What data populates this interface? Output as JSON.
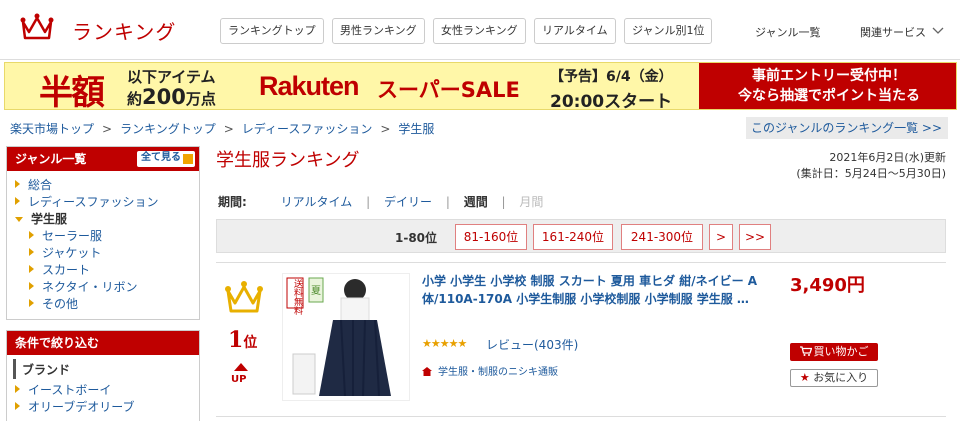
{
  "header": {
    "logo_text": "ランキング",
    "nav": [
      "ランキングトップ",
      "男性ランキング",
      "女性ランキング",
      "リアルタイム",
      "ジャンル別1位"
    ],
    "genre_list": "ジャンル一覧",
    "related": "関連サービス"
  },
  "banner": {
    "half": "半額",
    "under_line1": "以下アイテム",
    "under_line2_pre": "約",
    "under_line2_num": "200",
    "under_line2_post": "万点",
    "rakuten": "Rakuten",
    "super": "スーパーSALE",
    "notice_line1": "【予告】6/4（金）",
    "notice_line2": "20:00スタート",
    "cta_line1": "事前エントリー受付中！",
    "cta_line2": "今なら抽選でポイント当たる"
  },
  "breadcrumb": [
    "楽天市場トップ",
    "ランキングトップ",
    "レディースファッション",
    "学生服"
  ],
  "breadcrumb_sep": ">",
  "genre_rank_link": "このジャンルのランキング一覧 >>",
  "sidebar": {
    "genre_title": "ジャンル一覧",
    "see_all": "全て見る",
    "items": [
      {
        "label": "総合"
      },
      {
        "label": "レディースファッション"
      },
      {
        "label": "学生服"
      },
      {
        "label": "セーラー服"
      },
      {
        "label": "ジャケット"
      },
      {
        "label": "スカート"
      },
      {
        "label": "ネクタイ・リボン"
      },
      {
        "label": "その他"
      }
    ],
    "filter_title": "条件で絞り込む",
    "brand_label": "ブランド",
    "brands": [
      "イーストボーイ",
      "オリーブデオリーブ"
    ]
  },
  "main": {
    "title": "学生服ランキング",
    "updated_line1": "2021年6月2日(水)更新",
    "updated_line2": "(集計日：5月24日～5月30日)",
    "period_label": "期間:",
    "periods": [
      "リアルタイム",
      "デイリー",
      "週間",
      "月間"
    ],
    "period_sep": "|",
    "pager_current": "1-80位",
    "pages": [
      "81-160位",
      "161-240位",
      "241-300位",
      ">",
      ">>"
    ]
  },
  "item": {
    "rank": "1",
    "rank_suffix": "位",
    "up": "UP",
    "thumb_badge1": "送料無料",
    "thumb_badge2": "夏",
    "title": "小学 小学生 小学校 制服 スカート 夏用 車ヒダ 紺/ネイビー A体/110A-170A 小学生制服 小学校制服 小学制服 学生服 …",
    "rating": 4.5,
    "stars": "★★★★★",
    "review": "レビュー(403件)",
    "shop": "学生服・制服のニシキ通販",
    "price": "3,490円",
    "cart": "買い物かご",
    "fav": "お気に入り"
  },
  "colors": {
    "brand_red": "#bf0000",
    "link_blue": "#1e5a9c",
    "banner_yellow": "#fff7a8",
    "star_gold": "#e8a000"
  }
}
